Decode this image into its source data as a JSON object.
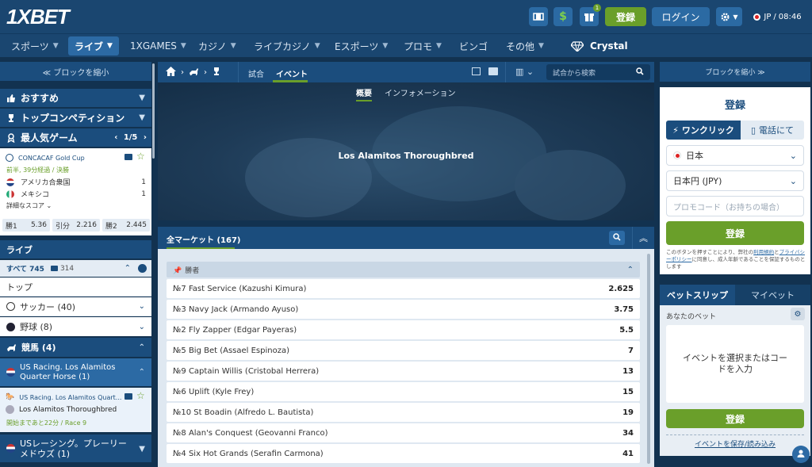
{
  "brand": {
    "logo_main": "1X",
    "logo_rest": "BET"
  },
  "header": {
    "register": "登録",
    "login": "ログイン",
    "lang": "JP",
    "separator": "/",
    "time": "08:46"
  },
  "nav": [
    {
      "label": "スポーツ"
    },
    {
      "label": "ライブ"
    },
    {
      "label": "1XGAMES"
    },
    {
      "label": "カジノ"
    },
    {
      "label": "ライブカジノ"
    },
    {
      "label": "Eスポーツ"
    },
    {
      "label": "プロモ"
    },
    {
      "label": "ビンゴ"
    },
    {
      "label": "その他"
    },
    {
      "label": "Crystal"
    }
  ],
  "left": {
    "collapse": "≪ ブロックを縮小",
    "recommended": "おすすめ",
    "top_competitions": "トップコンペティション",
    "popular_games": "最人気ゲーム",
    "popular_pager": "1/5",
    "featured": {
      "league": "CONCACAF Gold Cup",
      "status": "前半, 39分経過 / 決勝",
      "team1": "アメリカ合衆国",
      "score1": "1",
      "team2": "メキシコ",
      "score2": "1",
      "more": "詳細なスコア",
      "odds": [
        {
          "label": "勝1",
          "value": "5.36"
        },
        {
          "label": "引分",
          "value": "2.216"
        },
        {
          "label": "勝2",
          "value": "2.445"
        }
      ]
    },
    "live_title": "ライブ",
    "all_label": "すべて 745",
    "video_count": "314",
    "top_label": "トップ",
    "sports": [
      {
        "label": "サッカー (40)"
      },
      {
        "label": "野球 (8)"
      }
    ],
    "horse_racing": "競馬 (4)",
    "us_racing": "US Racing. Los Alamitos Quarter Horse (1)",
    "event_league": "US Racing. Los Alamitos Quart...",
    "event_name": "Los Alamitos Thoroughbred",
    "event_time": "開始まであと22分 / Race 9",
    "us_racing_2": "USレーシング。プレーリーメドウズ (1)"
  },
  "center": {
    "tab_match": "試合",
    "tab_event": "イベント",
    "search_placeholder": "試合から検索",
    "hero_tab_overview": "概要",
    "hero_tab_info": "インフォメーション",
    "hero_title": "Los Alamitos Thoroughbred",
    "markets_title": "全マーケット (167)",
    "group_title": "勝者",
    "runners": [
      {
        "name": "№7 Fast Service (Kazushi Kimura)",
        "odd": "2.625"
      },
      {
        "name": "№3 Navy Jack (Armando Ayuso)",
        "odd": "3.75"
      },
      {
        "name": "№2 Fly Zapper (Edgar Payeras)",
        "odd": "5.5"
      },
      {
        "name": "№5 Big Bet (Assael Espinoza)",
        "odd": "7"
      },
      {
        "name": "№9 Captain Willis (Cristobal Herrera)",
        "odd": "13"
      },
      {
        "name": "№6 Uplift (Kyle Frey)",
        "odd": "15"
      },
      {
        "name": "№10 St Boadin (Alfredo L. Bautista)",
        "odd": "19"
      },
      {
        "name": "№8 Alan's Conquest (Geovanni Franco)",
        "odd": "34"
      },
      {
        "name": "№4 Six Hot Grands (Serafin Carmona)",
        "odd": "41"
      }
    ]
  },
  "right": {
    "collapse": "ブロックを縮小 ≫",
    "reg_title": "登録",
    "tab_oneclick": "ワンクリック",
    "tab_phone": "電話にて",
    "country": "日本",
    "currency": "日本円 (JPY)",
    "promo_placeholder": "プロモコード（お持ちの場合）",
    "register_btn": "登録",
    "terms_a": "このボタンを押すことにより、弊社の",
    "terms_link1": "利用規約",
    "terms_b": "と",
    "terms_link2": "プライバシーポリシー",
    "terms_c": "に同意し、成人年齢であることを保証するものとします",
    "betslip": "ベットスリップ",
    "mybets": "マイベット",
    "your_bet": "あなたのベット",
    "empty_msg": "イベントを選択またはコードを入力",
    "register_btn2": "登録",
    "save_load": "イベントを保存/読み込み"
  },
  "colors": {
    "bg": "#123250",
    "bar": "#1b4d7d",
    "green": "#6a9f2a",
    "accent": "#2c6aa4"
  }
}
